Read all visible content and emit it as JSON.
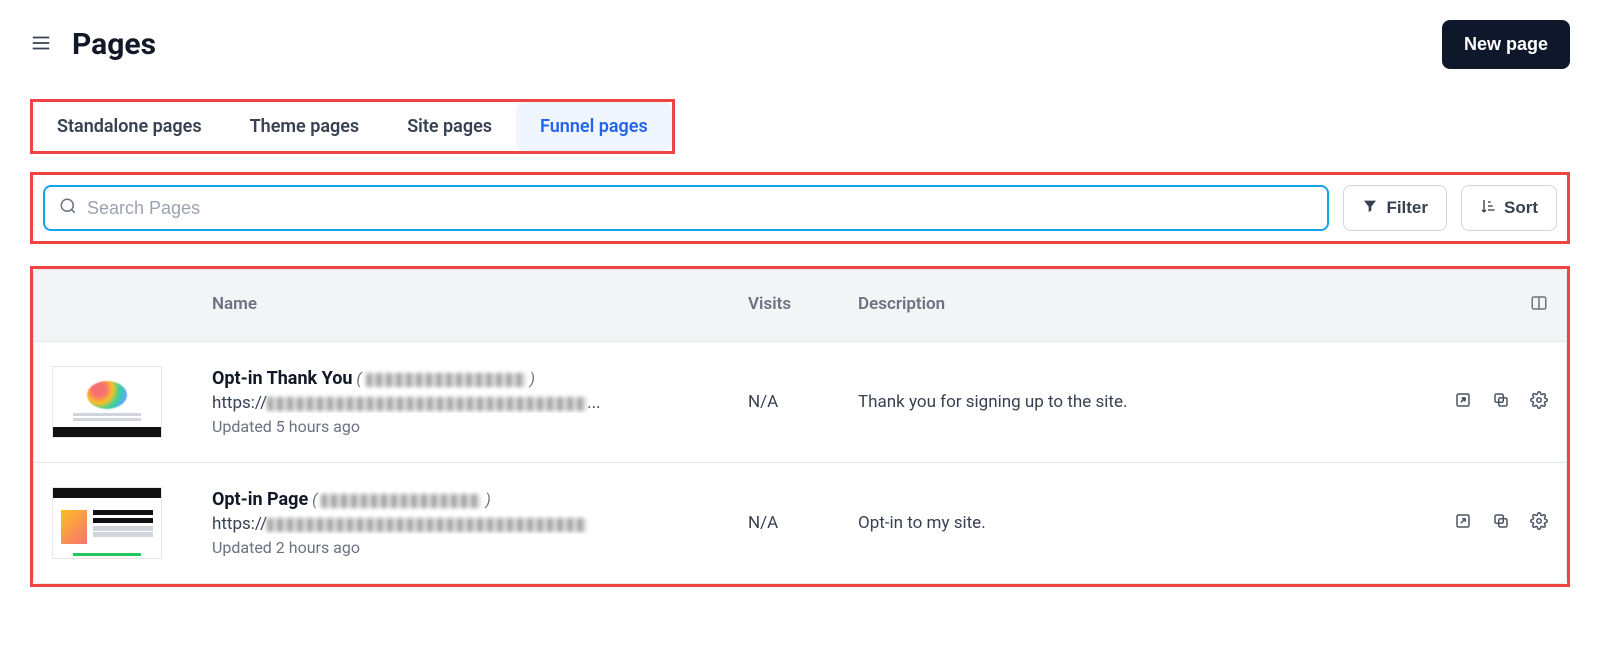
{
  "header": {
    "title": "Pages",
    "new_button": "New page"
  },
  "tabs": {
    "items": [
      {
        "label": "Standalone pages",
        "active": false
      },
      {
        "label": "Theme pages",
        "active": false
      },
      {
        "label": "Site pages",
        "active": false
      },
      {
        "label": "Funnel pages",
        "active": true
      }
    ]
  },
  "search": {
    "placeholder": "Search Pages",
    "value": ""
  },
  "buttons": {
    "filter": "Filter",
    "sort": "Sort"
  },
  "table": {
    "headers": {
      "name": "Name",
      "visits": "Visits",
      "description": "Description"
    },
    "rows": [
      {
        "title": "Opt-in Thank You",
        "url_prefix": "https://",
        "updated": "Updated 5 hours ago",
        "visits": "N/A",
        "description": "Thank you for signing up to the site."
      },
      {
        "title": "Opt-in Page",
        "url_prefix": "https://",
        "updated": "Updated 2 hours ago",
        "visits": "N/A",
        "description": "Opt-in to my site."
      }
    ]
  }
}
